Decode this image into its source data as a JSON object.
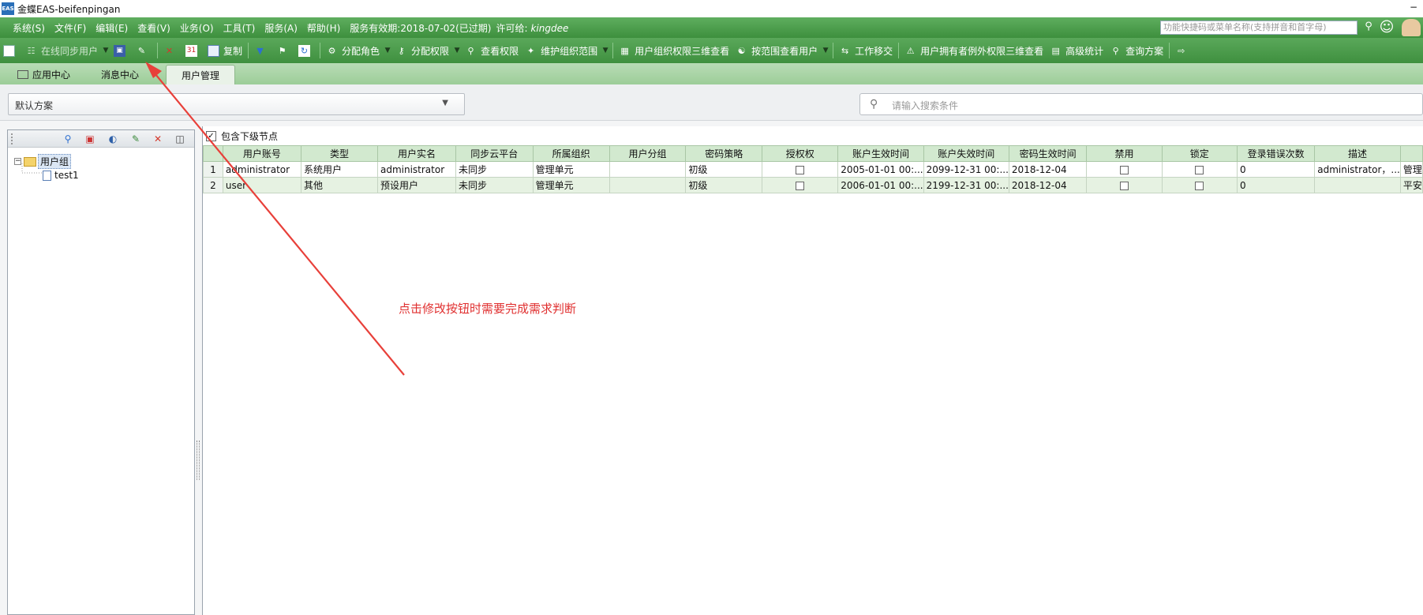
{
  "window": {
    "app_icon": "EAS",
    "title": "金蝶EAS-beifenpingan"
  },
  "menubar": {
    "items": [
      "系统(S)",
      "文件(F)",
      "编辑(E)",
      "查看(V)",
      "业务(O)",
      "工具(T)",
      "服务(A)",
      "帮助(H)"
    ],
    "validity": "服务有效期:2018-07-02(已过期)",
    "license_label": "许可给:",
    "license_user": "kingdee",
    "search_placeholder": "功能快捷码或菜单名称(支持拼音和首字母)"
  },
  "toolbar": {
    "online_sync": "在线同步用户",
    "copy": "复制",
    "assign_role": "分配角色",
    "assign_perm": "分配权限",
    "view_perm": "查看权限",
    "maintain_org_range": "维护组织范围",
    "user_org_perm_3d": "用户组织权限三维查看",
    "view_users_by_range": "按范围查看用户",
    "work_transfer": "工作移交",
    "user_exception_perm_3d": "用户拥有者例外权限三维查看",
    "advanced_stats": "高级统计",
    "query_scheme": "查询方案"
  },
  "tabs": [
    "应用中心",
    "消息中心",
    "用户管理"
  ],
  "scheme": {
    "value": "默认方案"
  },
  "search": {
    "placeholder": "请输入搜索条件"
  },
  "tree": {
    "root": "用户组",
    "child": "test1"
  },
  "include_children": "包含下级节点",
  "table": {
    "headers": [
      "",
      "用户账号",
      "类型",
      "用户实名",
      "同步云平台",
      "所属组织",
      "用户分组",
      "密码策略",
      "授权权",
      "账户生效时间",
      "账户失效时间",
      "密码生效时间",
      "禁用",
      "锁定",
      "登录错误次数",
      "描述",
      ""
    ],
    "rows": [
      {
        "no": "1",
        "account": "administrator",
        "type": "系统用户",
        "realname": "administrator",
        "sync": "未同步",
        "org": "管理单元",
        "group": "",
        "pwd_policy": "初级",
        "eff": "2005-01-01 00:...",
        "exp": "2099-12-31 00:...",
        "pwd_eff": "2018-12-04",
        "err": "0",
        "desc": "administrator，...",
        "extra": "管理"
      },
      {
        "no": "2",
        "account": "user",
        "type": "其他",
        "realname": "预设用户",
        "sync": "未同步",
        "org": "管理单元",
        "group": "",
        "pwd_policy": "初级",
        "eff": "2006-01-01 00:...",
        "exp": "2199-12-31 00:...",
        "pwd_eff": "2018-12-04",
        "err": "0",
        "desc": "",
        "extra": "平安"
      }
    ]
  },
  "annotation": "点击修改按钮时需要完成需求判断",
  "colors": {
    "menubar": "#4a9c4a",
    "annotation": "#e03030",
    "table_header": "#d2e9cf"
  }
}
